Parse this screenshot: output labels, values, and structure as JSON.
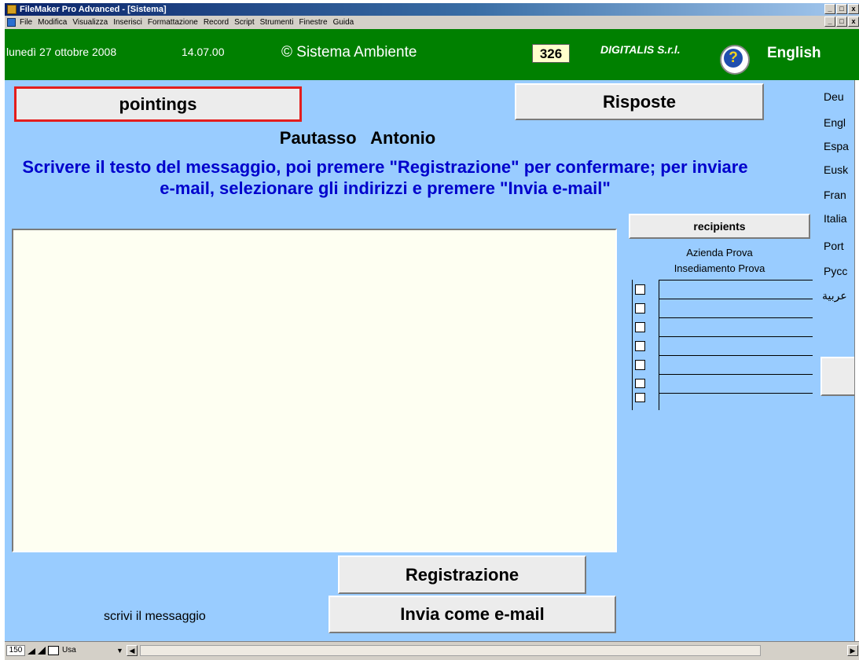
{
  "window": {
    "title": "FileMaker Pro Advanced - [Sistema]",
    "controls": [
      "_",
      "□",
      "x"
    ]
  },
  "menubar": {
    "items": [
      "File",
      "Modifica",
      "Visualizza",
      "Inserisci",
      "Formattazione",
      "Record",
      "Script",
      "Strumenti",
      "Finestre",
      "Guida"
    ],
    "controls": [
      "_",
      "□",
      "x"
    ]
  },
  "header": {
    "date": "lunedì 27 ottobre 2008",
    "time": "14.07.00",
    "system_name": "© Sistema Ambiente",
    "count": "326",
    "company": "DIGITALIS S.r.l.",
    "help_icon_label": "?",
    "language": "English"
  },
  "main": {
    "pointings_label": "pointings",
    "risposte_label": "Risposte",
    "person_name": "Pautasso   Antonio",
    "instructions": "Scrivere il testo del messaggio, poi premere \"Registrazione\" per confermare; per inviare e-mail, selezionare gli indirizzi e premere \"Invia e-mail\"",
    "message_text": "",
    "registrazione_label": "Registrazione",
    "invia_label": "Invia come e-mail",
    "hint": "scrivi il messaggio"
  },
  "recipients": {
    "header_label": "recipients",
    "company": "Azienda Prova",
    "site": "Insediamento Prova",
    "rows": 7
  },
  "languages": [
    "Deu",
    "Engl",
    "Espa",
    "Eusk",
    "Fran",
    "Italia",
    "Port",
    "Pycc",
    "عربية"
  ],
  "statusbar": {
    "zoom": "150",
    "mode": "Usa"
  },
  "colors": {
    "header_green": "#008000",
    "content_blue": "#99ccff",
    "instructions_blue": "#0000cc",
    "pointings_border_red": "#e31d1d",
    "count_bg": "#ffffcc"
  }
}
